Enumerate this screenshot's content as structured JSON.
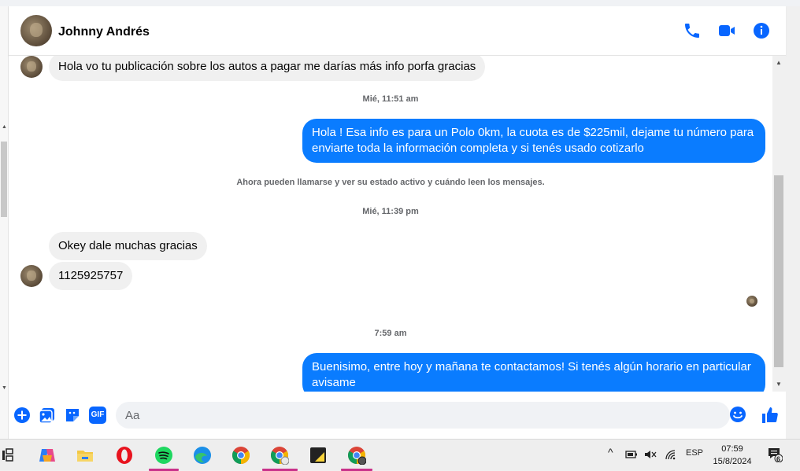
{
  "contact": {
    "name": "Johnny Andrés"
  },
  "messages": {
    "m1": "Hola vo tu publicación sobre los autos a pagar me darías más info porfa gracias",
    "ts1": "Mié, 11:51 am",
    "m2": "Hola ! Esa info es para un Polo 0km, la cuota es de $225mil, dejame tu número para enviarte toda la información completa y si tenés usado cotizarlo",
    "notice": "Ahora pueden llamarse y ver su estado activo y cuándo leen los mensajes.",
    "ts2": "Mié, 11:39 pm",
    "m3": "Okey dale muchas gracias",
    "m4": "1125925757",
    "ts3": "7:59 am",
    "m5": "Buenisimo, entre hoy y mañana te contactamos! Si tenés algún horario en particular avisame"
  },
  "composer": {
    "placeholder": "Aa",
    "gif_label": "GIF"
  },
  "taskbar": {
    "lang": "ESP",
    "time": "07:59",
    "date": "15/8/2024",
    "notification_count": "6"
  },
  "colors": {
    "accent": "#0a7cff",
    "incoming_bubble": "#f0f0f0",
    "icon_blue": "#0866ff"
  }
}
